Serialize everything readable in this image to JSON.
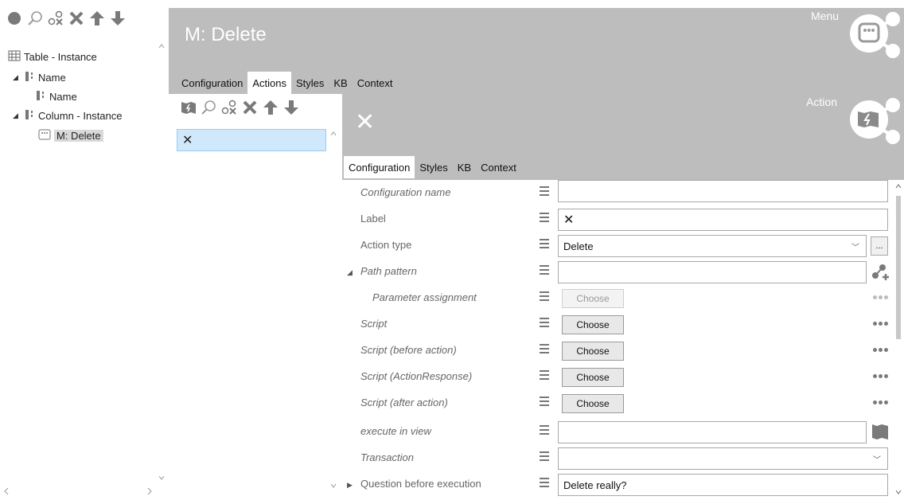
{
  "left_tree": {
    "items": [
      {
        "label": "Table - Instance"
      },
      {
        "label": "Name"
      },
      {
        "label": "Name"
      },
      {
        "label": "Column - Instance"
      },
      {
        "label": "M: Delete"
      }
    ]
  },
  "menu": {
    "title": "M: Delete",
    "corner_label": "Menu",
    "tabs": [
      "Configuration",
      "Actions",
      "Styles",
      "KB",
      "Context"
    ],
    "active_tab": "Actions"
  },
  "actions_list": {
    "items": [
      {
        "label": "✕"
      }
    ]
  },
  "action": {
    "title_glyph": "✕",
    "corner_label": "Action",
    "tabs": [
      "Configuration",
      "Styles",
      "KB",
      "Context"
    ],
    "active_tab": "Configuration"
  },
  "properties": [
    {
      "label": "Configuration name",
      "value": ""
    },
    {
      "label": "Label",
      "value": "✕"
    },
    {
      "label": "Action type",
      "value": "Delete",
      "ellipsis": "..."
    },
    {
      "label": "Path pattern",
      "value": ""
    },
    {
      "label": "Parameter assignment",
      "button": "Choose"
    },
    {
      "label": "Script",
      "button": "Choose"
    },
    {
      "label": "Script (before action)",
      "button": "Choose"
    },
    {
      "label": "Script (ActionResponse)",
      "button": "Choose"
    },
    {
      "label": "Script (after action)",
      "button": "Choose"
    },
    {
      "label": "execute in view",
      "value": ""
    },
    {
      "label": "Transaction",
      "value": ""
    },
    {
      "label": "Question before execution",
      "value": "Delete really?"
    }
  ],
  "colors": {
    "header_gray": "#bdbdbd",
    "selection_blue": "#cfe8fb",
    "icon_gray": "#7a7a7a"
  }
}
